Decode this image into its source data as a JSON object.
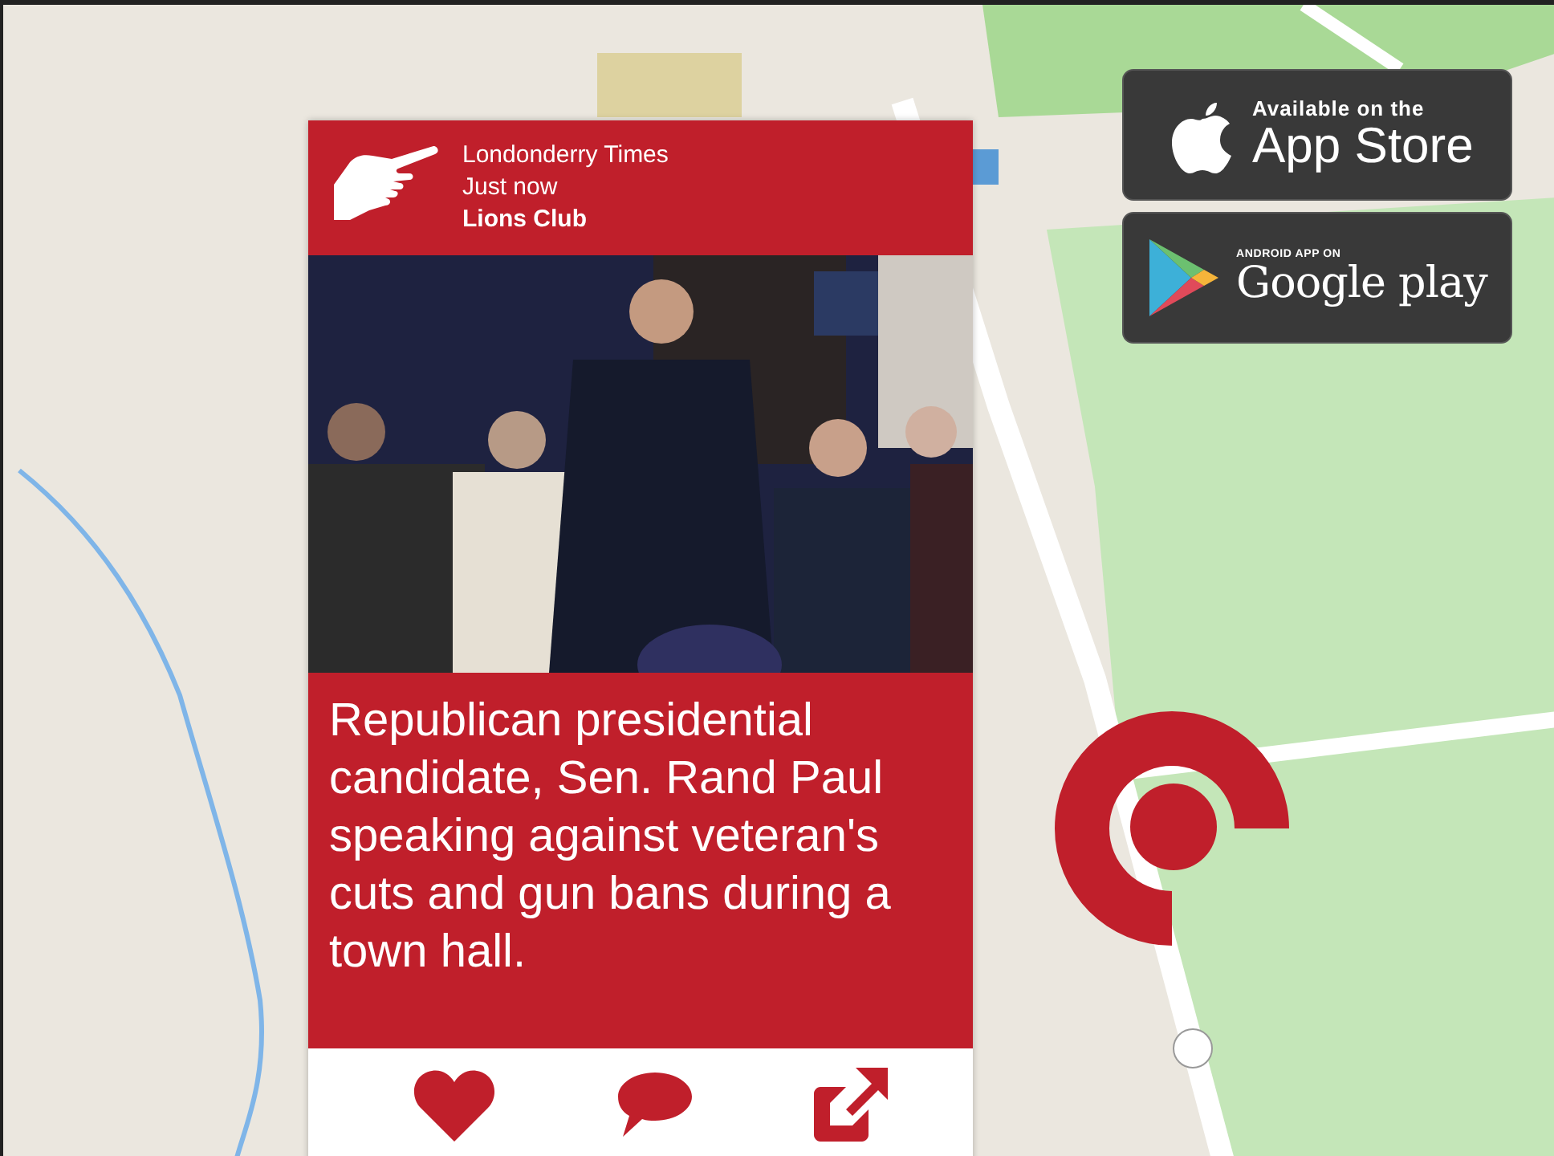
{
  "post": {
    "source": "Londonderry Times",
    "time": "Just now",
    "group": "Lions Club",
    "caption": "Republican presidential candidate, Sen. Rand Paul speaking against veteran's cuts and gun bans during a town hall.",
    "actions": [
      {
        "kind": "like"
      },
      {
        "kind": "comment"
      },
      {
        "kind": "share"
      }
    ]
  },
  "store_badges": [
    {
      "kind": "apple",
      "small_text": "Available on the",
      "large_text": "App Store"
    },
    {
      "kind": "google",
      "small_text": "ANDROID APP ON",
      "large_text": "Google play"
    }
  ]
}
